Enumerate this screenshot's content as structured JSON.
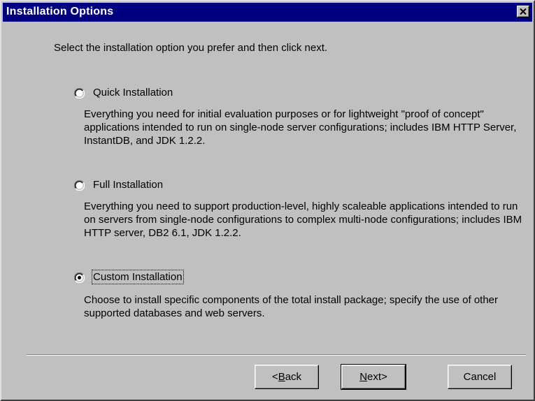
{
  "window": {
    "title": "Installation Options"
  },
  "instruction": "Select the installation option you prefer and then click next.",
  "options": [
    {
      "label": "Quick Installation",
      "selected": false,
      "description": "Everything you need for initial evaluation purposes or for lightweight \"proof of concept\" applications intended to run on single-node server configurations; includes IBM HTTP Server, InstantDB, and JDK 1.2.2."
    },
    {
      "label": "Full Installation",
      "selected": false,
      "description": "Everything you need to support production-level, highly scaleable applications intended to run on servers from single-node configurations to complex multi-node configurations; includes IBM HTTP server, DB2 6.1, JDK 1.2.2."
    },
    {
      "label": "Custom Installation",
      "selected": true,
      "description": "Choose to install specific components of the total install package; specify the use of other supported databases and web servers."
    }
  ],
  "buttons": {
    "back": {
      "accel": "B",
      "rest": "ack",
      "prefix": "< "
    },
    "next": {
      "accel": "N",
      "rest": "ext",
      "suffix": " >"
    },
    "cancel": "Cancel"
  }
}
